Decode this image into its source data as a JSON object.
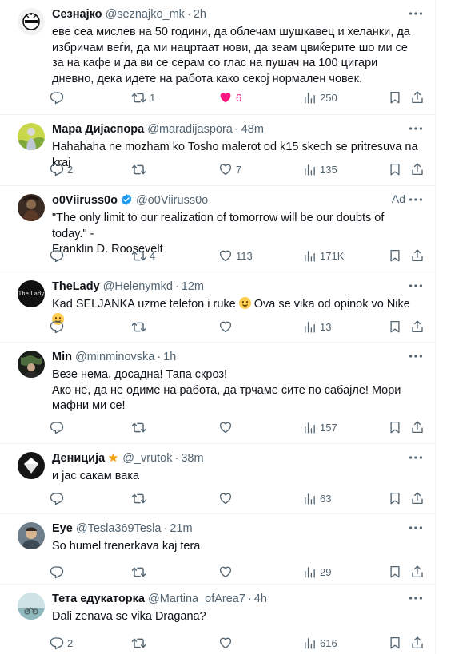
{
  "tweets": [
    {
      "name": "Сезнајко",
      "handle": "@seznajko_mk",
      "time": "2h",
      "text": "еве сеа мислев на 50 години, да облечам шушкавец и хеланки, да избричам веѓи, да ми нацртаат нови, да зеам цвиќерите шо ми се за на кафе и да ви се серам со глас на пушач на 100 цигари дневно, дека идете на работа како секој нормален човек.",
      "replies": "",
      "retweets": "1",
      "likes": "6",
      "views": "250",
      "liked": true
    },
    {
      "name": "Мара Дијаспора",
      "handle": "@maradijaspora",
      "time": "48m",
      "text": "Hahahaha ne mozham ko Tosho malerot od k15 skech se pritresuva na kraj",
      "replies": "2",
      "retweets": "",
      "likes": "7",
      "views": "135"
    },
    {
      "name": "o0Viiruss0o",
      "handle": "@o0Viiruss0o",
      "ad_label": "Ad",
      "text_line1": "\"The only limit to our realization of tomorrow will be our doubts of today.\" -",
      "text_line2": "Franklin D. Roosevelt",
      "replies": "",
      "retweets": "4",
      "likes": "113",
      "views": "171K"
    },
    {
      "name": "TheLady",
      "handle": "@Helenymkd",
      "time": "12m",
      "avatar_text": "The Lady",
      "text_a": "Kad SELJANKA uzme telefon i ruke",
      "text_b": "Ova se vika od opinok vo Nike",
      "replies": "",
      "retweets": "",
      "likes": "",
      "views": "13"
    },
    {
      "name": "Min",
      "handle": "@minminovska",
      "time": "1h",
      "text_line1": "Везе нема, досадна! Тапа скроз!",
      "text_line2": "Ако не, да не одиме на работа, да трчаме сите по сабајле! Мори мафни ми се!",
      "replies": "",
      "retweets": "",
      "likes": "",
      "views": "157"
    },
    {
      "name": "Дениција",
      "handle": "@_vrutok",
      "time": "38m",
      "text": "и јас сакам вака",
      "replies": "",
      "retweets": "",
      "likes": "",
      "views": "63"
    },
    {
      "name": "Eye",
      "handle": "@Tesla369Tesla",
      "time": "21m",
      "text": "So humel trenerkava kaj tera",
      "replies": "",
      "retweets": "",
      "likes": "",
      "views": "29"
    },
    {
      "name": "Тета едукаторка",
      "handle": "@Martina_ofArea7",
      "time": "4h",
      "text": "Dali zenava se vika Dragana?",
      "replies": "2",
      "retweets": "",
      "likes": "",
      "views": "616"
    }
  ],
  "colors": {
    "text": "#0f1419",
    "secondary": "#536471",
    "like_active": "#f91880",
    "verified": "#1d9bf0",
    "divider": "#eff3f4"
  },
  "icons": [
    "more-icon",
    "reply-icon",
    "retweet-icon",
    "like-icon",
    "views-icon",
    "bookmark-icon",
    "share-icon",
    "verified-icon",
    "star-icon",
    "laughing-emoji",
    "winking-emoji"
  ]
}
